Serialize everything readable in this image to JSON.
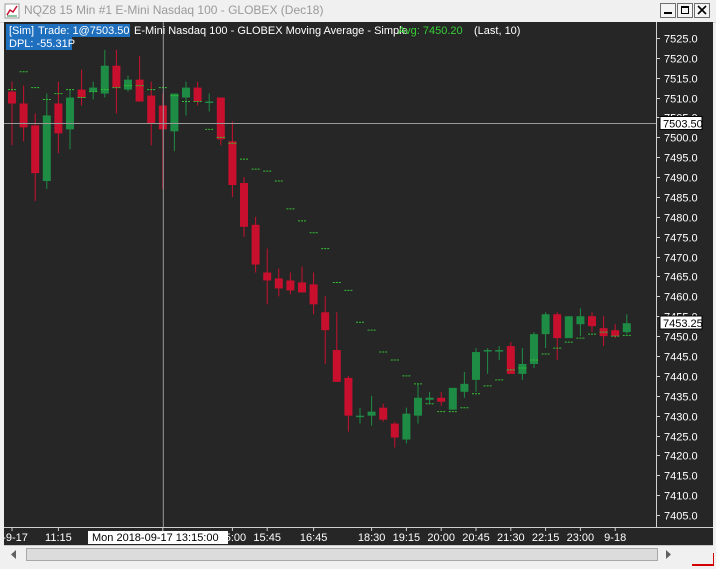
{
  "window": {
    "title": "NQZ8  15 Min   #1  E-Mini Nasdaq 100 - GLOBEX (Dec18)",
    "controls": [
      "minimize",
      "maximize",
      "close"
    ]
  },
  "overlay": {
    "sim_label": "[Sim]",
    "trade_text": "Trade: 1@7503.50",
    "study_text": "E-Mini Nasdaq 100 - GLOBEX Moving Average - Simple",
    "avg_label": "Avg: 7450.20",
    "params_text": "(Last, 10)",
    "dpl_label": "DPL: -55.31P"
  },
  "price_axis": {
    "crosshair_price": "7503.50",
    "last_price": "7453.25"
  },
  "time_axis": {
    "labels": [
      "8-9-17",
      "11:15",
      "13:15",
      "15:00",
      "15:45",
      "16:45",
      "18:30",
      "19:15",
      "20:00",
      "20:45",
      "21:30",
      "22:15",
      "23:00",
      "9-18"
    ],
    "crosshair_time": "Mon 2018-09-17   13:15:00"
  },
  "status": {
    "badge": "11"
  },
  "colors": {
    "up": "#1e8c44",
    "down": "#c8102e",
    "ma": "#35c035",
    "background": "#262626"
  },
  "chart_data": {
    "type": "candlestick",
    "title": "E-Mini Nasdaq 100 - GLOBEX (Dec18)",
    "ylim": [
      7402,
      7529
    ],
    "y_ticks": [
      7405,
      7410,
      7415,
      7420,
      7425,
      7430,
      7435,
      7440,
      7445,
      7450,
      7455,
      7460,
      7465,
      7470,
      7475,
      7480,
      7485,
      7490,
      7495,
      7500,
      7505,
      7510,
      7515,
      7520,
      7525
    ],
    "bars": [
      [
        7511.5,
        7514.0,
        7498.0,
        7508.5
      ],
      [
        7508.5,
        7513.0,
        7499.0,
        7502.5
      ],
      [
        7503.0,
        7506.0,
        7484.0,
        7491.0
      ],
      [
        7489.0,
        7511.0,
        7487.0,
        7505.5
      ],
      [
        7508.5,
        7514.0,
        7496.0,
        7501.0
      ],
      [
        7502.0,
        7512.0,
        7497.0,
        7510.0
      ],
      [
        7512.0,
        7517.0,
        7508.0,
        7510.0
      ],
      [
        7511.5,
        7514.0,
        7509.5,
        7512.5
      ],
      [
        7511.0,
        7522.0,
        7510.0,
        7518.0
      ],
      [
        7518.0,
        7522.0,
        7506.0,
        7512.5
      ],
      [
        7512.0,
        7515.5,
        7511.5,
        7514.5
      ],
      [
        7514.5,
        7520.5,
        7511.5,
        7509.0
      ],
      [
        7510.5,
        7514.0,
        7498.0,
        7503.5
      ],
      [
        7508.0,
        7511.0,
        7487.0,
        7502.0
      ],
      [
        7501.5,
        7511.0,
        7496.5,
        7511.0
      ],
      [
        7510.0,
        7514.0,
        7505.5,
        7512.5
      ],
      [
        7512.5,
        7514.0,
        7508.0,
        7509.0
      ],
      [
        7509.0,
        7511.0,
        7506.5,
        7509.0
      ],
      [
        7510.0,
        7508.0,
        7498.0,
        7499.5
      ],
      [
        7499.0,
        7504.0,
        7485.0,
        7488.0
      ],
      [
        7488.5,
        7490.0,
        7475.0,
        7477.5
      ],
      [
        7478.0,
        7480.0,
        7466.0,
        7468.0
      ],
      [
        7466.0,
        7472.0,
        7458.0,
        7464.0
      ],
      [
        7464.5,
        7467.0,
        7460.0,
        7462.0
      ],
      [
        7464.0,
        7466.0,
        7460.5,
        7461.5
      ],
      [
        7463.5,
        7467.5,
        7462.5,
        7461.0
      ],
      [
        7463.0,
        7466.0,
        7455.5,
        7458.0
      ],
      [
        7456.0,
        7460.0,
        7443.0,
        7451.5
      ],
      [
        7446.5,
        7456.0,
        7439.5,
        7438.5
      ],
      [
        7439.5,
        7440.0,
        7426.0,
        7430.0
      ],
      [
        7430.0,
        7432.0,
        7428.0,
        7430.0
      ],
      [
        7430.0,
        7435.0,
        7427.5,
        7431.0
      ],
      [
        7432.0,
        7433.0,
        7428.5,
        7429.0
      ],
      [
        7428.0,
        7428.5,
        7422.0,
        7424.5
      ],
      [
        7424.0,
        7432.0,
        7423.0,
        7430.5
      ],
      [
        7430.0,
        7438.0,
        7428.0,
        7434.5
      ],
      [
        7434.0,
        7436.0,
        7433.0,
        7434.5
      ],
      [
        7434.5,
        7436.0,
        7432.5,
        7433.5
      ],
      [
        7431.5,
        7436.5,
        7433.0,
        7437.0
      ],
      [
        7436.0,
        7441.0,
        7434.5,
        7438.0
      ],
      [
        7439.0,
        7447.0,
        7436.0,
        7446.0
      ],
      [
        7446.5,
        7447.0,
        7440.5,
        7446.5
      ],
      [
        7446.5,
        7447.5,
        7444.0,
        7446.5
      ],
      [
        7447.5,
        7448.5,
        7441.5,
        7440.5
      ],
      [
        7440.5,
        7447.0,
        7439.0,
        7443.0
      ],
      [
        7443.0,
        7451.0,
        7442.0,
        7450.5
      ],
      [
        7450.5,
        7456.0,
        7447.0,
        7455.5
      ],
      [
        7455.5,
        7456.0,
        7444.0,
        7449.5
      ],
      [
        7449.5,
        7455.0,
        7450.0,
        7455.0
      ],
      [
        7453.0,
        7457.0,
        7450.0,
        7455.0
      ],
      [
        7455.0,
        7456.0,
        7451.0,
        7452.5
      ],
      [
        7452.0,
        7455.0,
        7447.5,
        7450.0
      ],
      [
        7451.5,
        7453.0,
        7449.5,
        7450.0
      ],
      [
        7451.0,
        7455.5,
        7450.5,
        7453.25
      ]
    ],
    "ma": [
      7512,
      7516.5,
      7512.5,
      7509.5,
      7511,
      7512,
      7510,
      7511.5,
      7512,
      7512.5,
      7513,
      7513,
      7512,
      7512.5,
      7510.5,
      7509,
      7509,
      7502,
      7500,
      7498.5,
      7494.5,
      7492,
      7491.5,
      7489,
      7482,
      7479,
      7476,
      7472,
      7463.5,
      7461.5,
      7453.5,
      7451.5,
      7446,
      7444,
      7440,
      7438,
      7433,
      7431,
      7431,
      7432,
      7435.5,
      7437.5,
      7439,
      7441.5,
      7442,
      7444,
      7445.5,
      7447,
      7448.5,
      7449.5,
      7450.5,
      7451,
      7450,
      7450.2
    ]
  }
}
